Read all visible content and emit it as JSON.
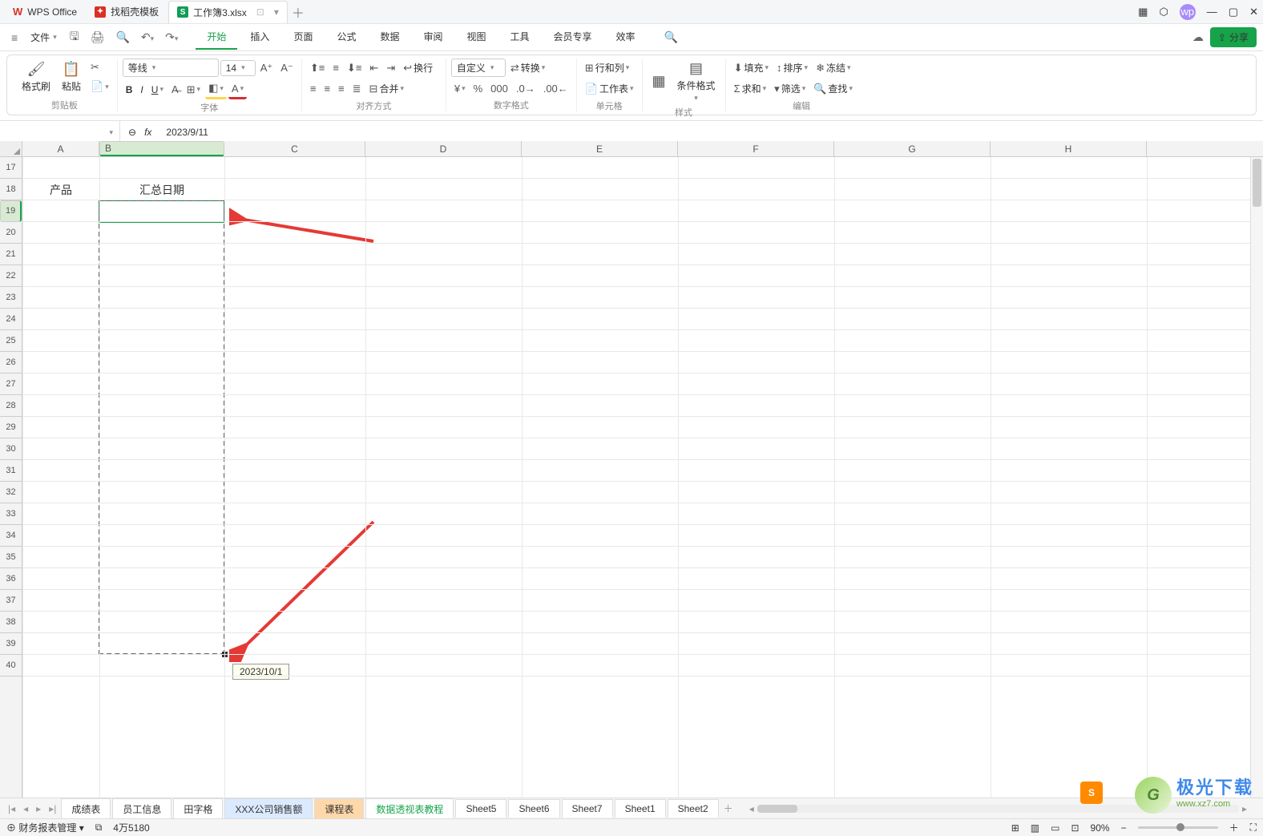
{
  "title": {
    "wps": "WPS Office",
    "find": "找稻壳模板",
    "doc": "工作簿3.xlsx"
  },
  "menu": {
    "file": "文件",
    "tabs": [
      "开始",
      "插入",
      "页面",
      "公式",
      "数据",
      "审阅",
      "视图",
      "工具",
      "会员专享",
      "效率"
    ]
  },
  "share": "分享",
  "ribbon": {
    "clipboard": {
      "fmt": "格式刷",
      "paste": "粘贴",
      "label": "剪贴板"
    },
    "font": {
      "name": "等线",
      "size": "14",
      "label": "字体"
    },
    "align": {
      "wrap": "换行",
      "merge": "合并",
      "label": "对齐方式"
    },
    "num": {
      "fmt": "自定义",
      "convert": "转换",
      "label": "数字格式"
    },
    "cell": {
      "rc": "行和列",
      "ws": "工作表",
      "label": "单元格"
    },
    "style": {
      "cond": "条件格式",
      "label": "样式"
    },
    "edit": {
      "fill": "填充",
      "sort": "排序",
      "freeze": "冻结",
      "sum": "求和",
      "filter": "筛选",
      "find": "查找",
      "label": "编辑"
    }
  },
  "namebox": "",
  "formula": "2023/9/11",
  "cols": [
    "A",
    "B",
    "C",
    "D",
    "E",
    "F",
    "G",
    "H"
  ],
  "rows": [
    17,
    18,
    19,
    20,
    21,
    22,
    23,
    24,
    25,
    26,
    27,
    28,
    29,
    30,
    31,
    32,
    33,
    34,
    35,
    36,
    37,
    38,
    39,
    40
  ],
  "cells": {
    "A18": "产品",
    "B18": "汇总日期",
    "B19": "2023/9/11"
  },
  "tooltip": "2023/10/1",
  "sheets": [
    "成绩表",
    "员工信息",
    "田字格",
    "XXX公司销售额",
    "课程表",
    "数据透视表教程",
    "Sheet5",
    "Sheet6",
    "Sheet7",
    "Sheet1",
    "Sheet2"
  ],
  "status": {
    "mgr": "财务报表管理",
    "count": "4万5180",
    "zoom": "90%"
  },
  "watermark": {
    "brand": "极光下载",
    "url": "www.xz7.com"
  }
}
